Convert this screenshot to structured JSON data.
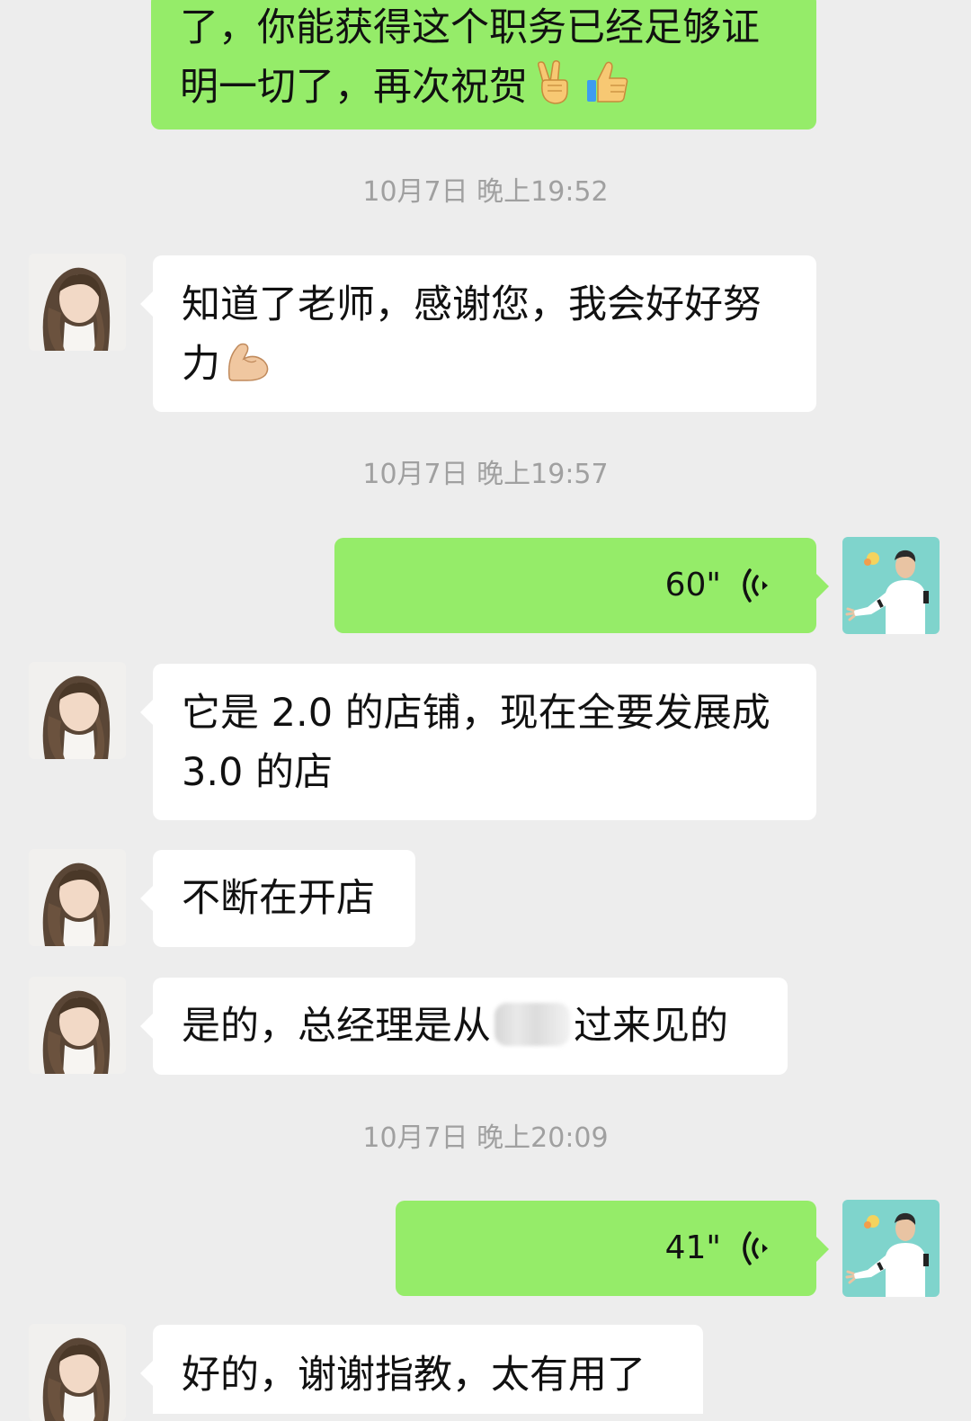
{
  "messages": {
    "m0_line1": "了，你能获得这个职务已经足够证",
    "m0_line2": "明一切了，再次祝贺",
    "t1": "10月7日 晚上19:52",
    "m1_line1": "知道了老师，感谢您，我会好好努",
    "m1_line2": "力",
    "t2": "10月7日 晚上19:57",
    "v1_duration": "60\"",
    "m2_line1": "它是 2.0 的店铺，现在全要发展成",
    "m2_line2": "3.0 的店",
    "m3": "不断在开店",
    "m4_before": "是的，总经理是从",
    "m4_after": "过来见的",
    "t3": "10月7日 晚上20:09",
    "v2_duration": "41\"",
    "m5": "好的，谢谢指教，太有用了"
  },
  "icons": {
    "emoji_1": "victory-hand-icon",
    "emoji_2": "thumbs-up-icon",
    "emoji_3": "flexed-biceps-icon",
    "voice": "voice-wave-icon"
  },
  "colors": {
    "background": "#ededed",
    "outgoing_bubble": "#95ec69",
    "incoming_bubble": "#ffffff",
    "timestamp": "#a0a0a0"
  }
}
